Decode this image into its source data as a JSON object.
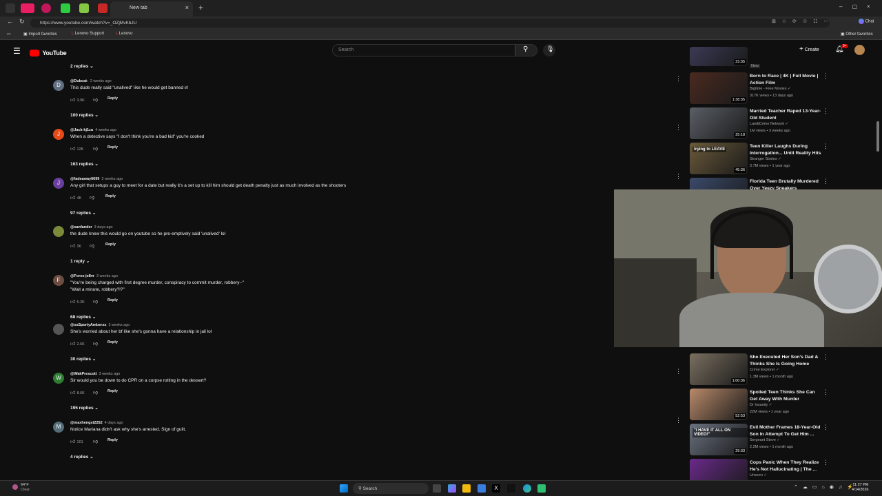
{
  "browser": {
    "active_tab": "New tab",
    "url": "https://www.youtube.com/watch?v=_OZjMvKbJU",
    "favorites": [
      "Import favorites",
      "Lenovo Support",
      "Lenovo"
    ],
    "other_favorites": "Other favorites",
    "copilot": "Chat"
  },
  "header": {
    "logo": "YouTube",
    "search_placeholder": "Search",
    "create": "Create",
    "notif_badge": "9+"
  },
  "comments": [
    {
      "top_replies": "2 replies"
    },
    {
      "handle": "@Dubcat-",
      "age": "2 weeks ago",
      "text": "This dude really said \"unalived\" like he would get banned irl",
      "likes": "3.9K",
      "reply": "Reply",
      "replies": "100 replies",
      "avatar": "D",
      "color": "#5f6f80"
    },
    {
      "handle": "@Jack-kj1zu",
      "age": "4 weeks ago",
      "text": "When a detective says \"I don't think you're a bad kid\" you're cooked",
      "likes": "12K",
      "reply": "Reply",
      "replies": "163 replies",
      "avatar": "J",
      "color": "#e64a19"
    },
    {
      "handle": "@fadeaway6699",
      "age": "2 weeks ago",
      "text": "Any girl that setups a guy to meet for a date but really it's a set up to kill him should get death penalty just as much involved as the shooters",
      "likes": "4K",
      "reply": "Reply",
      "replies": "97 replies",
      "avatar": "J",
      "color": "#6a3fa0"
    },
    {
      "handle": "@sanfander",
      "age": "3 days ago",
      "text": "the dude knew this would go on youtube so he pre-emptively said 'unalived' lol",
      "likes": "36",
      "reply": "Reply",
      "replies": "1 reply",
      "avatar": "",
      "color": "#7a8a3a"
    },
    {
      "handle": "@Forex-je8vr",
      "age": "3 weeks ago",
      "text": "\"You're being charged with first degree murder, conspiracy to commit murder, robbery--\"",
      "text2": "\"Wait a minute, robbery?!?\"",
      "likes": "5.2K",
      "reply": "Reply",
      "replies": "68 replies",
      "avatar": "F",
      "color": "#6d4c41"
    },
    {
      "handle": "@xxSportyAmberxx",
      "age": "2 weeks ago",
      "text": "She's worried about her bf like she's gonna have a relationship in jail lol",
      "likes": "2.6K",
      "reply": "Reply",
      "replies": "30 replies",
      "avatar": "",
      "color": "#555"
    },
    {
      "handle": "@WakPrescott",
      "age": "3 weeks ago",
      "text": "Sir would you be down to do CPR on a corpse rotting in the dessert?",
      "likes": "8.6K",
      "reply": "Reply",
      "replies": "195 replies",
      "avatar": "W",
      "color": "#2e7d32"
    },
    {
      "handle": "@maxhengst2252",
      "age": "4 days ago",
      "text": "Notice Mariana didn't ask why she's arrested. Sign of guilt.",
      "likes": "101",
      "reply": "Reply",
      "replies": "4 replies",
      "avatar": "M",
      "color": "#546e7a"
    }
  ],
  "sidebar": [
    {
      "title": "",
      "channel": "",
      "meta": "New",
      "duration": "23:35"
    },
    {
      "title": "Born to Race | 4K | Full Movie | Action Film",
      "channel": "Bigtime - Free Movies",
      "meta": "317K views • 13 days ago",
      "duration": "1:38:35"
    },
    {
      "title": "Married Teacher Raped 13-Year-Old Student",
      "channel": "Law&Crime Network",
      "meta": "1M views • 3 weeks ago",
      "duration": "25:18"
    },
    {
      "title": "Teen Killer Laughs During Interrogation... Until Reality Hits",
      "channel": "Stranger Stories",
      "meta": "3.7M views • 1 year ago",
      "duration": "45:36",
      "overlay": "trying to LEAVE"
    },
    {
      "title": "Florida Teen Brutally Murdered Over Yeezy Sneakers",
      "channel": "",
      "meta": "",
      "duration": ""
    },
    {
      "title": "She Executed Her Son's Dad & Thinks She Is Going Home",
      "channel": "Crime Explorer",
      "meta": "1.3M views • 1 month ago",
      "duration": "1:00:36"
    },
    {
      "title": "Spoiled Teen Thinks She Can Get Away With Murder",
      "channel": "Dr Insanity",
      "meta": "22M views • 1 year ago",
      "duration": "52:53"
    },
    {
      "title": "Evil Mother Frames 18-Year-Old Son In Attempt To Get Him ...",
      "channel": "Sergeant Steve",
      "meta": "2.2M views • 1 month ago",
      "duration": "29:33",
      "overlay": "\"I HAVE IT ALL ON VIDEO!\""
    },
    {
      "title": "Cops Panic When They Realize He's Not Hallucinating | The ...",
      "channel": "Unseen",
      "meta": "",
      "duration": ""
    }
  ],
  "taskbar": {
    "weather_temp": "64°F",
    "weather_desc": "Clear",
    "search": "Search",
    "time": "11:27 PM",
    "date": "4/14/2026"
  }
}
